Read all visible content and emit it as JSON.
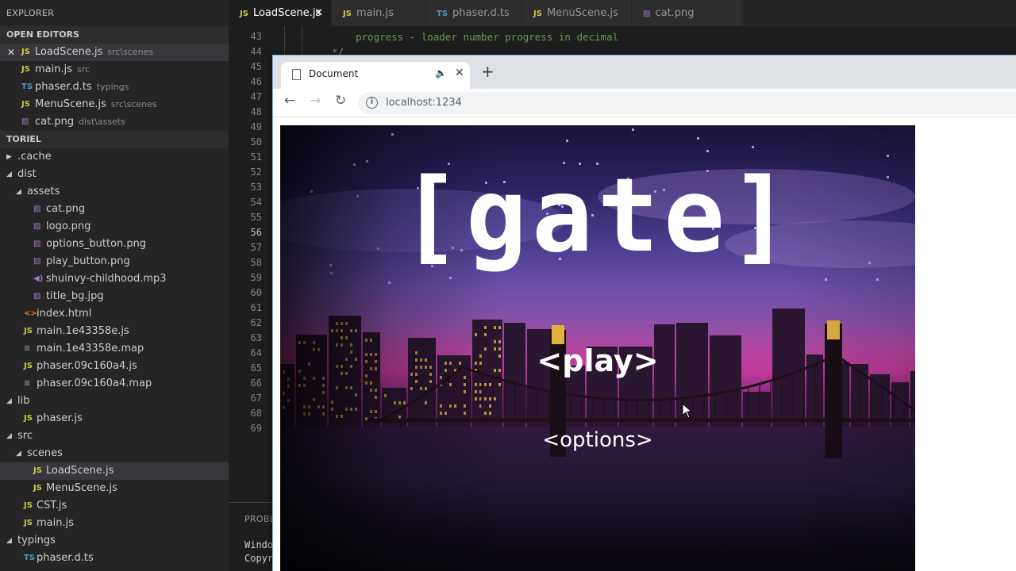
{
  "sidebar": {
    "title": "EXPLORER",
    "open_editors_label": "OPEN EDITORS",
    "open_editors": [
      {
        "name": "LoadScene.js",
        "desc": "src\\scenes",
        "icon": "JS",
        "type": "js"
      },
      {
        "name": "main.js",
        "desc": "src",
        "icon": "JS",
        "type": "js"
      },
      {
        "name": "phaser.d.ts",
        "desc": "typings",
        "icon": "TS",
        "type": "ts"
      },
      {
        "name": "MenuScene.js",
        "desc": "src\\scenes",
        "icon": "JS",
        "type": "js"
      },
      {
        "name": "cat.png",
        "desc": "dist\\assets",
        "icon": "▨",
        "type": "img"
      }
    ],
    "project_label": "TORIEL",
    "tree": [
      {
        "name": ".cache",
        "icon": "",
        "twisty": "▶",
        "indent": 0
      },
      {
        "name": "dist",
        "icon": "",
        "twisty": "◢",
        "indent": 0
      },
      {
        "name": "assets",
        "icon": "",
        "twisty": "◢",
        "indent": 1
      },
      {
        "name": "cat.png",
        "icon": "▨",
        "twisty": "",
        "indent": 2,
        "type": "img"
      },
      {
        "name": "logo.png",
        "icon": "▨",
        "twisty": "",
        "indent": 2,
        "type": "img"
      },
      {
        "name": "options_button.png",
        "icon": "▨",
        "twisty": "",
        "indent": 2,
        "type": "img"
      },
      {
        "name": "play_button.png",
        "icon": "▨",
        "twisty": "",
        "indent": 2,
        "type": "img"
      },
      {
        "name": "shuinvy-childhood.mp3",
        "icon": "◀)",
        "twisty": "",
        "indent": 2,
        "type": "audio"
      },
      {
        "name": "title_bg.jpg",
        "icon": "▨",
        "twisty": "",
        "indent": 2,
        "type": "img"
      },
      {
        "name": "index.html",
        "icon": "<>",
        "twisty": "",
        "indent": 1,
        "type": "html"
      },
      {
        "name": "main.1e43358e.js",
        "icon": "JS",
        "twisty": "",
        "indent": 1,
        "type": "js"
      },
      {
        "name": "main.1e43358e.map",
        "icon": "≡",
        "twisty": "",
        "indent": 1,
        "type": "map"
      },
      {
        "name": "phaser.09c160a4.js",
        "icon": "JS",
        "twisty": "",
        "indent": 1,
        "type": "js"
      },
      {
        "name": "phaser.09c160a4.map",
        "icon": "≡",
        "twisty": "",
        "indent": 1,
        "type": "map"
      },
      {
        "name": "lib",
        "icon": "",
        "twisty": "◢",
        "indent": 0
      },
      {
        "name": "phaser.js",
        "icon": "JS",
        "twisty": "",
        "indent": 1,
        "type": "js"
      },
      {
        "name": "src",
        "icon": "",
        "twisty": "◢",
        "indent": 0
      },
      {
        "name": "scenes",
        "icon": "",
        "twisty": "◢",
        "indent": 1
      },
      {
        "name": "LoadScene.js",
        "icon": "JS",
        "twisty": "",
        "indent": 2,
        "type": "js",
        "active": true
      },
      {
        "name": "MenuScene.js",
        "icon": "JS",
        "twisty": "",
        "indent": 2,
        "type": "js"
      },
      {
        "name": "CST.js",
        "icon": "JS",
        "twisty": "",
        "indent": 1,
        "type": "js"
      },
      {
        "name": "main.js",
        "icon": "JS",
        "twisty": "",
        "indent": 1,
        "type": "js"
      },
      {
        "name": "typings",
        "icon": "",
        "twisty": "◢",
        "indent": 0
      },
      {
        "name": "phaser.d.ts",
        "icon": "TS",
        "twisty": "",
        "indent": 1,
        "type": "ts"
      }
    ]
  },
  "tabs": [
    {
      "name": "LoadScene.js",
      "icon": "JS",
      "type": "js",
      "active": true,
      "close": "✕"
    },
    {
      "name": "main.js",
      "icon": "JS",
      "type": "js"
    },
    {
      "name": "phaser.d.ts",
      "icon": "TS",
      "type": "ts"
    },
    {
      "name": "MenuScene.js",
      "icon": "JS",
      "type": "js"
    },
    {
      "name": "cat.png",
      "icon": "▨",
      "type": "img"
    }
  ],
  "editor": {
    "line_numbers": [
      "43",
      "44",
      "45",
      "46",
      "47",
      "48",
      "49",
      "50",
      "51",
      "52",
      "53",
      "54",
      "55",
      "56",
      "57",
      "58",
      "59",
      "60",
      "61",
      "62",
      "63",
      "64",
      "65",
      "66",
      "67",
      "68",
      "69"
    ],
    "current_line": "56",
    "code_lines": [
      "progress - loader number progress in decimal",
      "*/"
    ]
  },
  "panel": {
    "tab_label": "PROBLI",
    "lines": [
      "Windo",
      "Copyr"
    ]
  },
  "browser": {
    "tab_title": "Document",
    "audio_icon": "🔈",
    "close_icon": "✕",
    "new_tab": "+",
    "back": "←",
    "forward": "→",
    "reload": "↻",
    "info": "i",
    "url": "localhost:1234"
  },
  "game": {
    "title": "[gate]",
    "play_label": "<play>",
    "options_label": "<options>"
  },
  "colors": {
    "editor_bg": "#1e1e1e",
    "sidebar_bg": "#252526",
    "comment": "#6a9955",
    "js_icon": "#cbcb41",
    "ts_icon": "#519aba"
  }
}
